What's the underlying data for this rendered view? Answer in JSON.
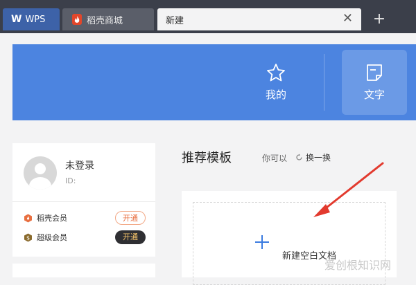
{
  "tabs": [
    {
      "label": "WPS",
      "logo": "W"
    },
    {
      "label": "稻壳商城",
      "icon": "flame-icon"
    },
    {
      "label": "新建",
      "close": "✕"
    }
  ],
  "tab_add": "+",
  "banner": {
    "color": "#4c84e0",
    "items": [
      {
        "label": "我的",
        "icon": "star-icon"
      },
      {
        "label": "文字",
        "icon": "document-icon",
        "selected": true
      }
    ]
  },
  "user": {
    "name": "未登录",
    "id_label": "ID:",
    "memberships": [
      {
        "label": "稻壳会员",
        "button": "开通",
        "icon_color": "#e86f40"
      },
      {
        "label": "超级会员",
        "button": "开通",
        "icon_color": "#8a6a2c"
      }
    ]
  },
  "templates": {
    "title": "推荐模板",
    "subtitle": "你可以",
    "refresh": "换一换",
    "blank_doc": "新建空白文档"
  },
  "watermark": "爱创根知识网",
  "colors": {
    "arrow": "#e23a2e"
  }
}
